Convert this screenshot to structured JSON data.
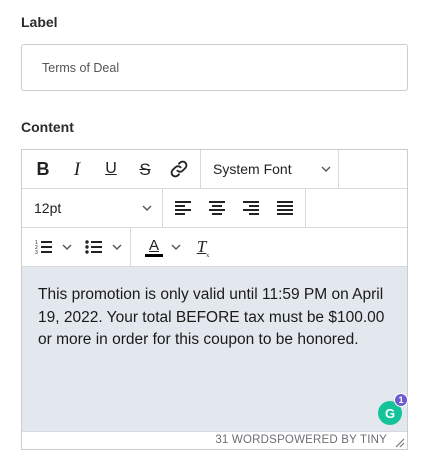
{
  "form": {
    "label_heading": "Label",
    "label_value": "Terms of Deal",
    "content_heading": "Content"
  },
  "toolbar": {
    "bold": "B",
    "italic": "I",
    "underline": "U",
    "strikethrough": "S",
    "link_icon": "link-icon",
    "font_family": "System Font",
    "font_size": "12pt",
    "align_left_icon": "align-left-icon",
    "align_center_icon": "align-center-icon",
    "align_right_icon": "align-right-icon",
    "align_justify_icon": "align-justify-icon",
    "numbered_list_icon": "numbered-list-icon",
    "bullet_list_icon": "bullet-list-icon",
    "text_color_letter": "A",
    "text_color": "#000000",
    "clear_format_letter": "T"
  },
  "editor": {
    "content": "This promotion is only valid until 11:59 PM on April 19, 2022.  Your total BEFORE tax must be $100.00 or more in order for this coupon to be honored.",
    "background": "#e3e8ee"
  },
  "statusbar": {
    "word_count": "31 WORDS",
    "powered_by": "POWERED BY TINY"
  },
  "grammarly": {
    "letter": "G",
    "badge_count": "1",
    "color": "#15c39a"
  }
}
